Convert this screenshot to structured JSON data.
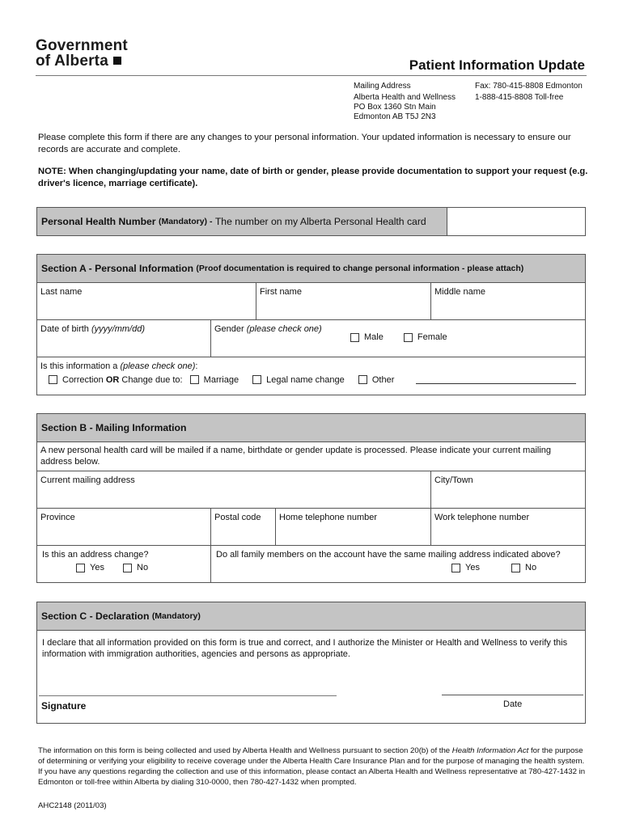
{
  "header": {
    "logo_line1": "Government",
    "logo_line2": "of Alberta",
    "title": "Patient Information Update",
    "mailing_address": [
      "Mailing Address",
      "Alberta Health and Wellness",
      "PO Box 1360 Stn Main",
      "Edmonton AB T5J 2N3"
    ],
    "contact": [
      "Fax: 780-415-8808  Edmonton",
      "1-888-415-8808 Toll-free"
    ]
  },
  "intro": "Please complete this form if there are any changes to your personal information. Your updated information is necessary to ensure our records are accurate and complete.",
  "note": "NOTE: When changing/updating your name, date of birth or gender, please provide documentation to support your request (e.g. driver's licence, marriage certificate).",
  "phn": {
    "label": "Personal Health Number",
    "mandatory": "(Mandatory) -",
    "desc": "The number on my Alberta Personal Health card",
    "value": ""
  },
  "section_a": {
    "title": "Section A - Personal Information",
    "subtitle": "(Proof documentation is required to change personal information - please attach)",
    "last_name": "Last name",
    "first_name": "First name",
    "middle_name": "Middle name",
    "dob_label": "Date of birth",
    "dob_hint": "(yyyy/mm/dd)",
    "gender_label": "Gender",
    "gender_hint": "(please check one)",
    "male": "Male",
    "female": "Female",
    "info_label": "Is this information a",
    "info_hint": "(please check one)",
    "correction": "Correction",
    "or": "OR",
    "change_due": "Change due to:",
    "marriage": "Marriage",
    "legal": "Legal name change",
    "other": "Other"
  },
  "section_b": {
    "title": "Section B - Mailing Information",
    "notice": "A new personal health card will be mailed if a name, birthdate or gender update is processed.  Please indicate your current mailing address below.",
    "address": "Current mailing address",
    "city": "City/Town",
    "province": "Province",
    "postal": "Postal code",
    "home_phone": "Home telephone number",
    "work_phone": "Work telephone number",
    "address_change": "Is this an address change?",
    "family_same": "Do all family members on the account have the same mailing address indicated above?",
    "yes": "Yes",
    "no": "No"
  },
  "section_c": {
    "title": "Section C - Declaration",
    "mandatory": "(Mandatory)",
    "declaration": "I declare that all information provided on this form is true and correct, and I authorize the Minister or Health and Wellness to verify this information with immigration authorities, agencies and persons as appropriate.",
    "signature": "Signature",
    "date": "Date"
  },
  "footer": {
    "text_before": "The information on this form is being collected and used by Alberta Health and Wellness pursuant to section 20(b) of the ",
    "act": "Health Information Act",
    "text_after": " for the purpose of determining or verifying your eligibility to receive coverage under the Alberta Health Care Insurance Plan and for the purpose of managing the health system.  If you have any questions regarding the collection and use of this information, please contact an Alberta Health and Wellness representative at 780-427-1432 in Edmonton or toll-free within Alberta by dialing 310-0000, then 780-427-1432 when prompted.",
    "form_code": "AHC2148 (2011/03)"
  }
}
